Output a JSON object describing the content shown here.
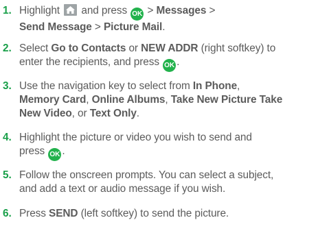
{
  "steps": [
    {
      "num": "1.",
      "parts": {
        "a": "Highlight",
        "b": "and press",
        "c": ">",
        "d": "Messages",
        "e": ">",
        "f": "Send Message",
        "g": ">",
        "h": "Picture Mail",
        "i": "."
      }
    },
    {
      "num": "2.",
      "parts": {
        "a": "Select",
        "b": "Go to Contacts",
        "c": "or",
        "d": "NEW ADDR",
        "e": "(right softkey) to",
        "f": "enter the recipients, and press",
        "g": "."
      }
    },
    {
      "num": "3.",
      "parts": {
        "a": "Use the navigation key to select from",
        "b": "In Phone",
        "c": ",",
        "d": "Memory Card",
        "e": ",",
        "f": "Online Albums",
        "g": ",",
        "h": "Take New Picture Take",
        "i": "New Video",
        "j": ", or",
        "k": "Text Only",
        "l": "."
      }
    },
    {
      "num": "4.",
      "parts": {
        "a": "Highlight the picture or video you wish to send and",
        "b": "press",
        "c": "."
      }
    },
    {
      "num": "5.",
      "parts": {
        "a": "Follow the onscreen prompts. You can select a subject,",
        "b": "and add a text or audio message if you wish."
      }
    },
    {
      "num": "6.",
      "parts": {
        "a": "Press",
        "b": "SEND",
        "c": "(left softkey) to send the picture."
      }
    }
  ],
  "icons": {
    "home": "home-icon",
    "ok": "OK"
  },
  "colors": {
    "number": "#1aa04a",
    "ok_button": "#22b24c",
    "home_button": "#9ea4a6",
    "text": "#5b5b5b"
  }
}
